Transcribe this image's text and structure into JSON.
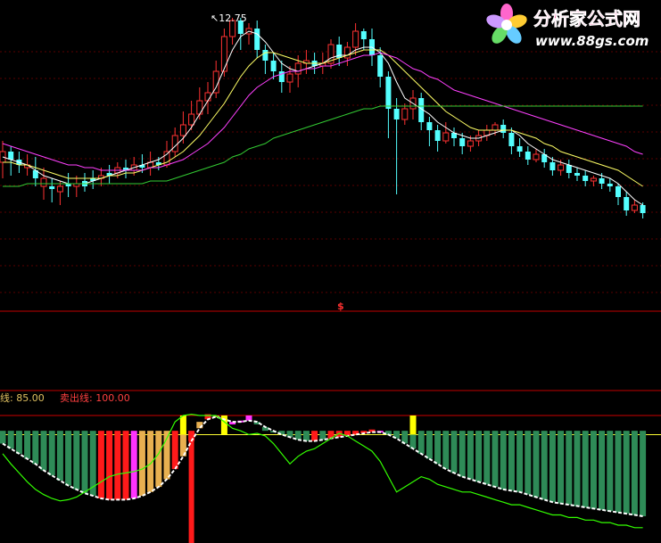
{
  "watermark": {
    "name": "分析家公式网",
    "url": "www.88gs.com"
  },
  "colors": {
    "background": "#000000",
    "candle_up": "#ff3232",
    "candle_down": "#54ffff",
    "ma_short": "#ffffff",
    "ma_mid": "#ffff66",
    "ma_long": "#ff40ff",
    "ma_longest": "#33cc33",
    "panel_divider": "#c00000",
    "hist_green": "#2e8b57",
    "hist_red": "#ff1a1a",
    "hist_tan": "#e8b050",
    "hist_magenta": "#ff33ff",
    "signal_yellow": "#ffff00",
    "line_white": "#ffffff",
    "line_green": "#33ff00",
    "ref_line_red": "#cc0000",
    "ref_line_yellow": "#ffff33"
  },
  "main_panel": {
    "peak_annotation": "12.75",
    "panel_marker": "$"
  },
  "indicator_panel": {
    "buy_line_label": "线: 85.00",
    "sell_line_label": "卖出线: 100.00",
    "buy_line_value": 85,
    "sell_line_value": 100
  },
  "chart_data": {
    "type": "candlestick",
    "title": "",
    "price_max": 12.75,
    "candles": [
      [
        46,
        50,
        40,
        54,
        1
      ],
      [
        50,
        47,
        41,
        52,
        0
      ],
      [
        47,
        45,
        42,
        50,
        0
      ],
      [
        45,
        44,
        41,
        49,
        1
      ],
      [
        43,
        40,
        37,
        48,
        0
      ],
      [
        40,
        37,
        32,
        44,
        1
      ],
      [
        37,
        36,
        31,
        40,
        0
      ],
      [
        35,
        37,
        30,
        39,
        1
      ],
      [
        37,
        38,
        33,
        42,
        0
      ],
      [
        38,
        37,
        33,
        41,
        1
      ],
      [
        37,
        39,
        35,
        42,
        0
      ],
      [
        39,
        40,
        36,
        43,
        0
      ],
      [
        40,
        41,
        37,
        44,
        1
      ],
      [
        41,
        42,
        38,
        45,
        0
      ],
      [
        42,
        44,
        40,
        46,
        1
      ],
      [
        44,
        43,
        40,
        47,
        0
      ],
      [
        43,
        45,
        41,
        48,
        1
      ],
      [
        45,
        44,
        42,
        49,
        0
      ],
      [
        44,
        46,
        41,
        50,
        1
      ],
      [
        46,
        45,
        43,
        48,
        0
      ],
      [
        45,
        50,
        44,
        54,
        1
      ],
      [
        50,
        56,
        48,
        59,
        1
      ],
      [
        56,
        60,
        53,
        65,
        1
      ],
      [
        60,
        64,
        58,
        69,
        1
      ],
      [
        64,
        69,
        62,
        74,
        1
      ],
      [
        69,
        72,
        64,
        76,
        1
      ],
      [
        72,
        80,
        70,
        84,
        1
      ],
      [
        80,
        93,
        78,
        96,
        1
      ],
      [
        93,
        99,
        90,
        100,
        1
      ],
      [
        99,
        94,
        88,
        100,
        0
      ],
      [
        94,
        96,
        90,
        98,
        1
      ],
      [
        96,
        88,
        85,
        99,
        0
      ],
      [
        88,
        84,
        79,
        90,
        0
      ],
      [
        84,
        80,
        77,
        87,
        0
      ],
      [
        80,
        76,
        72,
        84,
        0
      ],
      [
        76,
        79,
        72,
        82,
        1
      ],
      [
        79,
        83,
        74,
        86,
        1
      ],
      [
        83,
        84,
        79,
        88,
        1
      ],
      [
        84,
        82,
        79,
        87,
        0
      ],
      [
        82,
        83,
        79,
        87,
        1
      ],
      [
        83,
        90,
        81,
        92,
        1
      ],
      [
        90,
        85,
        82,
        93,
        0
      ],
      [
        85,
        89,
        82,
        91,
        1
      ],
      [
        89,
        95,
        86,
        98,
        1
      ],
      [
        95,
        92,
        88,
        96,
        0
      ],
      [
        92,
        86,
        82,
        96,
        0
      ],
      [
        86,
        78,
        74,
        89,
        0
      ],
      [
        78,
        66,
        55,
        80,
        0
      ],
      [
        66,
        62,
        34,
        70,
        0
      ],
      [
        62,
        66,
        60,
        68,
        1
      ],
      [
        66,
        70,
        62,
        73,
        1
      ],
      [
        70,
        61,
        58,
        72,
        0
      ],
      [
        61,
        58,
        52,
        63,
        0
      ],
      [
        58,
        54,
        50,
        60,
        0
      ],
      [
        54,
        57,
        53,
        61,
        1
      ],
      [
        57,
        55,
        52,
        59,
        0
      ],
      [
        55,
        52,
        49,
        57,
        0
      ],
      [
        52,
        54,
        50,
        56,
        1
      ],
      [
        54,
        56,
        52,
        58,
        1
      ],
      [
        56,
        58,
        54,
        60,
        1
      ],
      [
        58,
        60,
        56,
        61,
        1
      ],
      [
        60,
        57,
        55,
        62,
        0
      ],
      [
        57,
        52,
        49,
        59,
        0
      ],
      [
        52,
        50,
        48,
        55,
        0
      ],
      [
        50,
        47,
        45,
        52,
        0
      ],
      [
        47,
        49,
        46,
        51,
        1
      ],
      [
        49,
        46,
        44,
        51,
        0
      ],
      [
        46,
        43,
        41,
        48,
        0
      ],
      [
        43,
        45,
        41,
        47,
        1
      ],
      [
        45,
        42,
        40,
        47,
        0
      ],
      [
        42,
        41,
        39,
        44,
        0
      ],
      [
        41,
        39,
        37,
        43,
        0
      ],
      [
        39,
        40,
        37,
        41,
        1
      ],
      [
        40,
        38,
        36,
        42,
        0
      ],
      [
        38,
        37,
        35,
        40,
        0
      ],
      [
        37,
        33,
        30,
        38,
        0
      ],
      [
        33,
        28,
        26,
        35,
        0
      ],
      [
        28,
        30,
        27,
        32,
        1
      ],
      [
        30,
        27,
        25,
        31,
        0
      ]
    ],
    "series": [
      {
        "values": [
          48,
          47,
          46,
          45,
          43,
          41,
          40,
          39,
          38,
          38,
          38,
          39,
          40,
          41,
          42,
          43,
          44,
          45,
          46,
          47,
          49,
          52,
          55,
          59,
          64,
          69,
          74,
          81,
          88,
          93,
          95,
          94,
          91,
          87,
          83,
          81,
          80,
          81,
          82,
          83,
          85,
          86,
          86,
          88,
          89,
          89,
          87,
          83,
          76,
          70,
          68,
          66,
          64,
          61,
          59,
          57,
          56,
          55,
          55,
          56,
          57,
          58,
          58,
          56,
          53,
          51,
          49,
          47,
          46,
          45,
          44,
          43,
          42,
          41,
          40,
          38,
          35,
          32,
          30
        ]
      },
      {
        "values": [
          46,
          46,
          45,
          45,
          44,
          43,
          42,
          41,
          40,
          40,
          40,
          40,
          40,
          41,
          41,
          42,
          42,
          43,
          44,
          45,
          46,
          48,
          50,
          53,
          56,
          60,
          64,
          68,
          73,
          78,
          82,
          85,
          87,
          87,
          86,
          85,
          84,
          83,
          83,
          83,
          84,
          85,
          86,
          87,
          88,
          88,
          88,
          86,
          83,
          80,
          77,
          74,
          71,
          68,
          65,
          63,
          61,
          59,
          58,
          58,
          58,
          58,
          58,
          57,
          56,
          55,
          53,
          52,
          50,
          49,
          48,
          47,
          46,
          45,
          44,
          43,
          41,
          39,
          37
        ]
      },
      {
        "values": [
          53,
          52,
          51,
          50,
          49,
          48,
          47,
          46,
          45,
          45,
          44,
          44,
          43,
          43,
          43,
          43,
          43,
          43,
          44,
          44,
          45,
          46,
          47,
          49,
          51,
          53,
          56,
          59,
          63,
          67,
          71,
          74,
          76,
          78,
          79,
          80,
          80,
          81,
          81,
          82,
          82,
          83,
          84,
          85,
          86,
          86,
          87,
          86,
          85,
          83,
          81,
          80,
          78,
          77,
          75,
          73,
          72,
          71,
          70,
          69,
          68,
          67,
          66,
          65,
          64,
          63,
          62,
          61,
          60,
          59,
          58,
          57,
          56,
          55,
          54,
          53,
          52,
          50,
          49
        ]
      },
      {
        "values": [
          37,
          37,
          37,
          38,
          38,
          38,
          38,
          38,
          38,
          38,
          38,
          38,
          38,
          38,
          38,
          38,
          38,
          38,
          39,
          39,
          39,
          40,
          41,
          42,
          43,
          44,
          45,
          46,
          48,
          49,
          51,
          52,
          53,
          55,
          56,
          57,
          58,
          59,
          60,
          61,
          62,
          63,
          64,
          65,
          66,
          66,
          67,
          67,
          67,
          67,
          67,
          67,
          67,
          67,
          67,
          67,
          67,
          67,
          67,
          67,
          67,
          67,
          67,
          67,
          67,
          67,
          67,
          67,
          67,
          67,
          67,
          67,
          67,
          67,
          67,
          67,
          67,
          67,
          67
        ]
      }
    ],
    "indicator": {
      "type": "bar",
      "values": [
        80,
        78,
        72,
        68,
        62,
        56,
        50,
        44,
        40,
        38,
        36,
        34,
        33,
        33,
        33,
        34,
        35,
        37,
        40,
        44,
        50,
        60,
        72,
        85,
        95,
        101,
        100,
        97,
        93,
        96,
        100,
        93,
        87,
        84,
        82,
        80,
        78,
        79,
        80,
        81,
        83,
        82,
        84,
        86,
        88,
        89,
        87,
        84,
        80,
        76,
        72,
        68,
        64,
        60,
        56,
        53,
        50,
        48,
        46,
        44,
        42,
        41,
        40,
        39,
        37,
        35,
        33,
        31,
        30,
        29,
        28,
        27,
        26,
        25,
        24,
        23,
        22,
        21,
        20
      ],
      "colors": [
        "g",
        "g",
        "g",
        "g",
        "g",
        "g",
        "g",
        "g",
        "g",
        "g",
        "g",
        "g",
        "r",
        "r",
        "r",
        "r",
        "m",
        "t",
        "t",
        "t",
        "t",
        "r",
        "t",
        "r",
        "t",
        "r",
        "t",
        "t",
        "m",
        "m",
        "m",
        "g",
        "g",
        "g",
        "g",
        "g",
        "g",
        "g",
        "r",
        "g",
        "r",
        "r",
        "r",
        "r",
        "r",
        "r",
        "m",
        "g",
        "g",
        "g",
        "g",
        "g",
        "g",
        "g",
        "g",
        "g",
        "g",
        "g",
        "g",
        "g",
        "g",
        "g",
        "g",
        "g",
        "g",
        "g",
        "g",
        "g",
        "g",
        "g",
        "g",
        "g",
        "g",
        "g",
        "g",
        "g",
        "g",
        "g",
        "g"
      ],
      "white_line": [
        78,
        74,
        70,
        66,
        62,
        57,
        53,
        49,
        45,
        42,
        39,
        37,
        35,
        34,
        34,
        34,
        35,
        37,
        40,
        44,
        50,
        58,
        68,
        80,
        90,
        97,
        99,
        97,
        95,
        95,
        96,
        95,
        91,
        88,
        85,
        83,
        81,
        80,
        80,
        81,
        82,
        83,
        84,
        85,
        86,
        87,
        87,
        85,
        82,
        78,
        74,
        70,
        66,
        62,
        58,
        55,
        52,
        50,
        48,
        46,
        44,
        42,
        41,
        40,
        38,
        36,
        34,
        32,
        31,
        30,
        29,
        28,
        27,
        26,
        25,
        24,
        23,
        22,
        21
      ],
      "green_line": [
        70,
        62,
        55,
        48,
        42,
        38,
        35,
        33,
        34,
        36,
        40,
        44,
        48,
        52,
        54,
        55,
        56,
        58,
        62,
        70,
        82,
        95,
        100,
        101,
        100,
        100,
        100,
        95,
        90,
        88,
        85,
        86,
        84,
        78,
        70,
        62,
        68,
        72,
        74,
        78,
        82,
        86,
        84,
        80,
        76,
        72,
        64,
        52,
        40,
        44,
        48,
        52,
        50,
        46,
        44,
        42,
        40,
        40,
        38,
        36,
        34,
        32,
        30,
        30,
        28,
        26,
        24,
        22,
        22,
        20,
        20,
        18,
        18,
        16,
        16,
        14,
        14,
        12,
        12
      ],
      "signal_bars": [
        22,
        27,
        50
      ],
      "spikes": [
        23
      ],
      "ref_lines": [
        100,
        85
      ]
    }
  }
}
